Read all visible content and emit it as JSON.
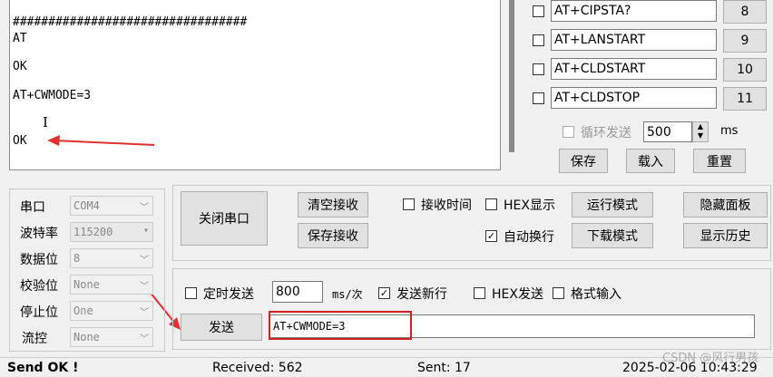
{
  "receive": {
    "lines": [
      "#################################",
      "AT",
      "OK",
      "AT+CWMODE=3",
      "OK"
    ]
  },
  "multi_send": [
    {
      "text": "AT+CIPSTA?",
      "num": "8"
    },
    {
      "text": "AT+LANSTART",
      "num": "9"
    },
    {
      "text": "AT+CLDSTART",
      "num": "10"
    },
    {
      "text": "AT+CLDSTOP",
      "num": "11"
    }
  ],
  "loop": {
    "label": "循环发送",
    "value": "500",
    "unit": "ms"
  },
  "multi_buttons": {
    "save": "保存",
    "load": "载入",
    "reset": "重置"
  },
  "serial": {
    "port_label": "串口",
    "port_value": "COM4",
    "baud_label": "波特率",
    "baud_value": "115200",
    "data_label": "数据位",
    "data_value": "8",
    "parity_label": "校验位",
    "parity_value": "None",
    "stop_label": "停止位",
    "stop_value": "One",
    "flow_label": "流控",
    "flow_value": "None"
  },
  "controls": {
    "close_port": "关闭串口",
    "clear_recv": "清空接收",
    "save_recv": "保存接收",
    "recv_time": "接收时间",
    "hex_display": "HEX显示",
    "run_mode": "运行模式",
    "hide_panel": "隐藏面板",
    "auto_wrap": "自动换行",
    "download_mode": "下载模式",
    "show_history": "显示历史"
  },
  "send_opts": {
    "timed_send": "定时发送",
    "interval": "800",
    "interval_unit": "ms/次",
    "send_newline": "发送新行",
    "hex_send": "HEX发送",
    "format_input": "格式输入"
  },
  "send": {
    "button": "发送",
    "input_value": "AT+CWMODE=3"
  },
  "statusbar": {
    "msg": "Send OK !",
    "received": "Received: 562",
    "sent": "Sent: 17",
    "datetime": "2025-02-06 10:43:29"
  },
  "watermark": "CSDN @风行男孩",
  "colors": {
    "annotation_red": "#e03030"
  }
}
